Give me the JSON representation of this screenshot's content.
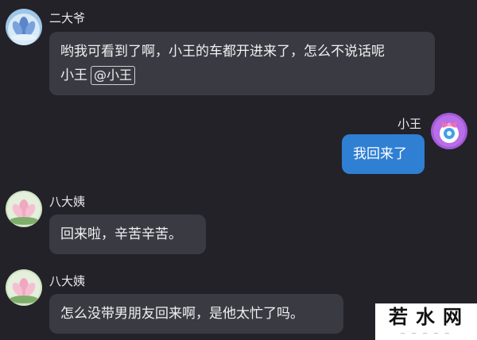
{
  "messages": [
    {
      "sender": "二大爷",
      "text": "哟我可看到了啊，小王的车都开进来了，怎么不说话呢",
      "text_line2": "小王",
      "mention": "@小王",
      "avatar_icon": "lotus-avatar-icon"
    },
    {
      "sender": "小王",
      "text": "我回来了",
      "avatar_icon": "cute-bow-avatar-icon",
      "bubble_color": "#2f7fd3"
    },
    {
      "sender": "八大姨",
      "text": "回来啦，辛苦辛苦。",
      "avatar_icon": "pink-lotus-avatar-icon"
    },
    {
      "sender": "八大姨",
      "text": "怎么没带男朋友回来啊，是他太忙了吗。",
      "avatar_icon": "pink-lotus-avatar-icon"
    }
  ],
  "watermark": {
    "text": "若水网"
  },
  "colors": {
    "background": "#222228",
    "bubble": "#3a3a42",
    "my_bubble": "#2f7fd3"
  }
}
